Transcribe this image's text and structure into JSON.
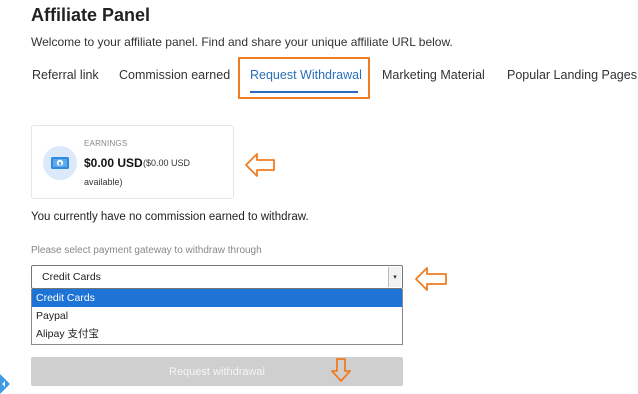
{
  "page": {
    "title": "Affiliate Panel",
    "welcome": "Welcome to your affiliate panel. Find and share your unique affiliate URL below."
  },
  "tabs": [
    {
      "label": "Referral link"
    },
    {
      "label": "Commission earned"
    },
    {
      "label": "Request Withdrawal",
      "active": true
    },
    {
      "label": "Marketing Material"
    },
    {
      "label": "Popular Landing Pages"
    }
  ],
  "earnings": {
    "label": "EARNINGS",
    "value": "$0.00 USD",
    "sub_line1": "($0.00 USD",
    "sub_line2": "available)",
    "icon": "money-icon"
  },
  "message": "You currently have no commission earned to withdraw.",
  "gateway": {
    "label": "Please select payment gateway to withdraw through",
    "selected": "Credit Cards",
    "options": [
      "Credit Cards",
      "Paypal",
      "Alipay 支付宝"
    ]
  },
  "submit_label": "Request withdrawal",
  "colors": {
    "accent": "#2a6ebb",
    "annotation": "#f07c22",
    "option_highlight": "#1e73d6",
    "disabled_button": "#cfcfcf"
  }
}
